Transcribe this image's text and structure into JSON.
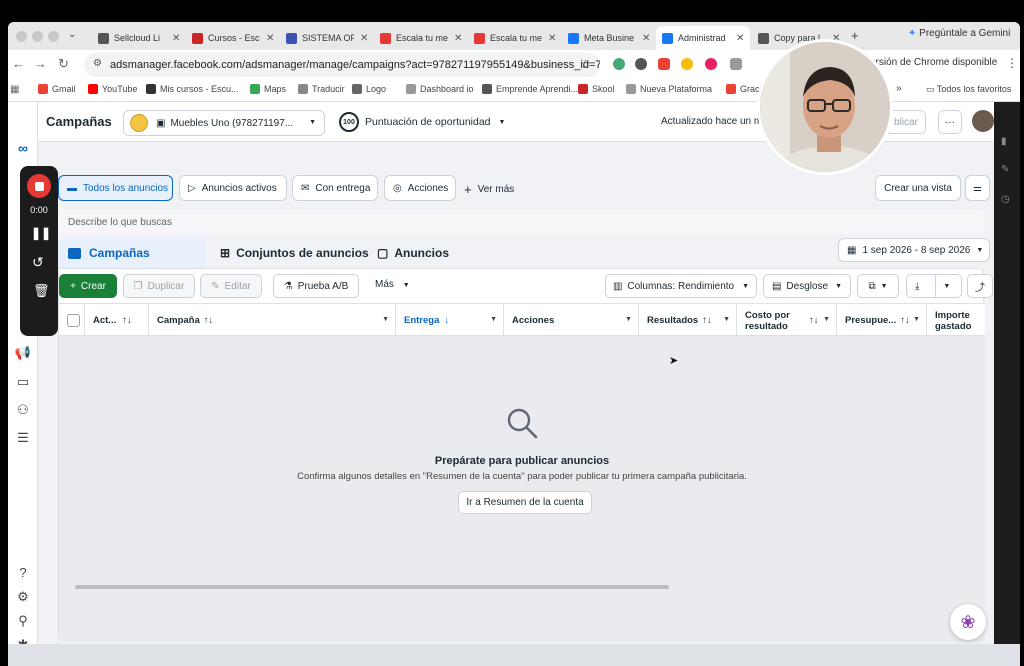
{
  "browser": {
    "tabs": [
      {
        "label": "Sellcloud Li",
        "icon": "sellcloud-icon",
        "color": "#555555"
      },
      {
        "label": "Cursos - Esc",
        "icon": "sk-icon",
        "color": "#c62828"
      },
      {
        "label": "SISTEMA OF",
        "icon": "shield-icon",
        "color": "#3f51b5"
      },
      {
        "label": "Escala tu me",
        "icon": "flame-icon",
        "color": "#e53935"
      },
      {
        "label": "Escala tu me",
        "icon": "flame-icon",
        "color": "#e53935"
      },
      {
        "label": "Meta Busine",
        "icon": "meta-icon",
        "color": "#1877f2"
      },
      {
        "label": "Administrad",
        "icon": "meta-icon",
        "color": "#1877f2"
      },
      {
        "label": "Copy para l",
        "icon": "globe-icon",
        "color": "#555555"
      }
    ],
    "new_tab": "+",
    "gemini_label": "Pregúntale a Gemini",
    "url": "adsmanager.facebook.com/adsmanager/manage/campaigns?act=978271197955149&business_id=70...",
    "update_text": "ersión de Chrome disponible",
    "bookmarks": [
      "Gmail",
      "YouTube",
      "Mis cursos - Escu...",
      "Maps",
      "Traducir",
      "Logo",
      "Dashboard io",
      "Emprende Aprendi...",
      "Skool",
      "Nueva Plataforma",
      "Graci"
    ],
    "bookmarks_more": "»",
    "all_bookmarks": "Todos los favoritos"
  },
  "recorder": {
    "time": "0:00"
  },
  "header": {
    "title": "Campañas",
    "account": "Muebles Uno (978271197...",
    "score_value": "100",
    "score_label": "Puntuación de oportunidad",
    "updated": "Actualizado hace un mom",
    "publish": "blicar",
    "more": "···"
  },
  "views": {
    "items": [
      "Todos los anuncios",
      "Anuncios activos",
      "Con entrega",
      "Acciones"
    ],
    "see_more": "Ver más",
    "create_view": "Crear una vista"
  },
  "search": {
    "placeholder": "Describe lo que buscas"
  },
  "level_tabs": [
    "Campañas",
    "Conjuntos de anuncios",
    "Anuncios"
  ],
  "date_range": "1 sep 2026 - 8 sep 2026",
  "actions": {
    "create": "Crear",
    "duplicate": "Duplicar",
    "edit": "Editar",
    "ab_test": "Prueba A/B",
    "more": "Más",
    "columns": "Columnas: Rendimiento",
    "breakdown": "Desglose"
  },
  "table": {
    "columns": [
      "Act...",
      "Campaña",
      "Entrega",
      "Acciones",
      "Resultados",
      "Costo por resultado",
      "Presupue...",
      "Importe gastado"
    ]
  },
  "empty_state": {
    "title": "Prepárate para publicar anuncios",
    "body": "Confirma algunos detalles en \"Resumen de la cuenta\" para poder publicar tu primera campaña publicitaria.",
    "button": "Ir a Resumen de la cuenta"
  },
  "colors": {
    "accent": "#0a66c2",
    "create_green": "#1a7f37",
    "rec_red": "#e53935"
  }
}
